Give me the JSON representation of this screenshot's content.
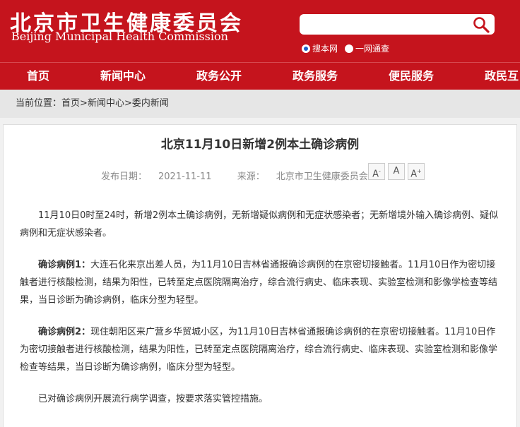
{
  "header": {
    "title": "北京市卫生健康委员会",
    "subtitle": "Beijing Municipal Health Commission",
    "search": {
      "placeholder": ""
    },
    "scope_options": [
      "搜本网",
      "一网通查"
    ],
    "scope_selected": "搜本网"
  },
  "nav": {
    "items": [
      "首页",
      "新闻中心",
      "政务公开",
      "政务服务",
      "便民服务",
      "政民互"
    ]
  },
  "breadcrumb": {
    "label": "当前位置：",
    "items": [
      "首页",
      "新闻中心",
      "委内新闻"
    ],
    "separator": ">"
  },
  "article": {
    "title": "北京11月10日新增2例本土确诊病例",
    "date_label": "发布日期：",
    "date": "2021-11-11",
    "source_label": "来源：",
    "source": "北京市卫生健康委员会",
    "font_buttons": [
      "A-",
      "A",
      "A+"
    ],
    "paragraphs": [
      {
        "lead": "",
        "text": "11月10日0时至24时，新增2例本土确诊病例，无新增疑似病例和无症状感染者；无新增境外输入确诊病例、疑似病例和无症状感染者。"
      },
      {
        "lead": "确诊病例1：",
        "text": "大连石化来京出差人员，为11月10日吉林省通报确诊病例的在京密切接触者。11月10日作为密切接触者进行核酸检测，结果为阳性，已转至定点医院隔离治疗，综合流行病史、临床表现、实验室检测和影像学检查等结果，当日诊断为确诊病例，临床分型为轻型。"
      },
      {
        "lead": "确诊病例2：",
        "text": "现住朝阳区来广营乡华贸城小区，为11月10日吉林省通报确诊病例的在京密切接触者。11月10日作为密切接触者进行核酸检测，结果为阳性，已转至定点医院隔离治疗，综合流行病史、临床表现、实验室检测和影像学检查等结果，当日诊断为确诊病例，临床分型为轻型。"
      },
      {
        "lead": "",
        "text": "已对确诊病例开展流行病学调查，按要求落实管控措施。"
      }
    ]
  },
  "colors": {
    "brand_red": "#c5141d",
    "breadcrumb_bg": "#e6e6e6"
  }
}
